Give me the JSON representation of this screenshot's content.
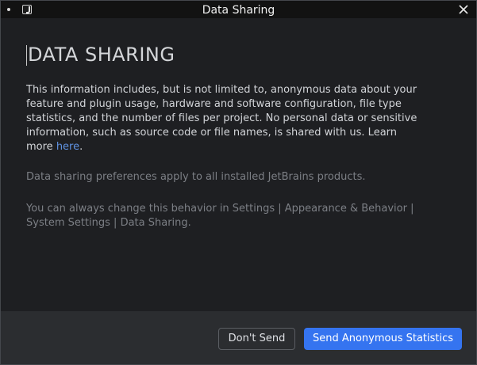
{
  "window": {
    "title": "Data Sharing"
  },
  "content": {
    "heading": "DATA SHARING",
    "paragraph1": "This information includes, but is not limited to, anonymous data about your feature and plugin usage, hardware and software configuration, file type statistics, and the number of files per project. No personal data or sensitive information, such as source code or file names, is shared with us. Learn more ",
    "link_text": "here",
    "link_suffix": ".",
    "paragraph2": "Data sharing preferences apply to all installed JetBrains products.",
    "paragraph3": "You can always change this behavior in Settings | Appearance & Behavior | System Settings | Data Sharing."
  },
  "footer": {
    "dont_send_label": "Don't Send",
    "send_label": "Send Anonymous Statistics"
  },
  "colors": {
    "primary": "#3574f0",
    "link": "#5f92e2",
    "background": "#1e1f22"
  },
  "icons": {
    "close": "close-icon",
    "app": "app-icon"
  }
}
